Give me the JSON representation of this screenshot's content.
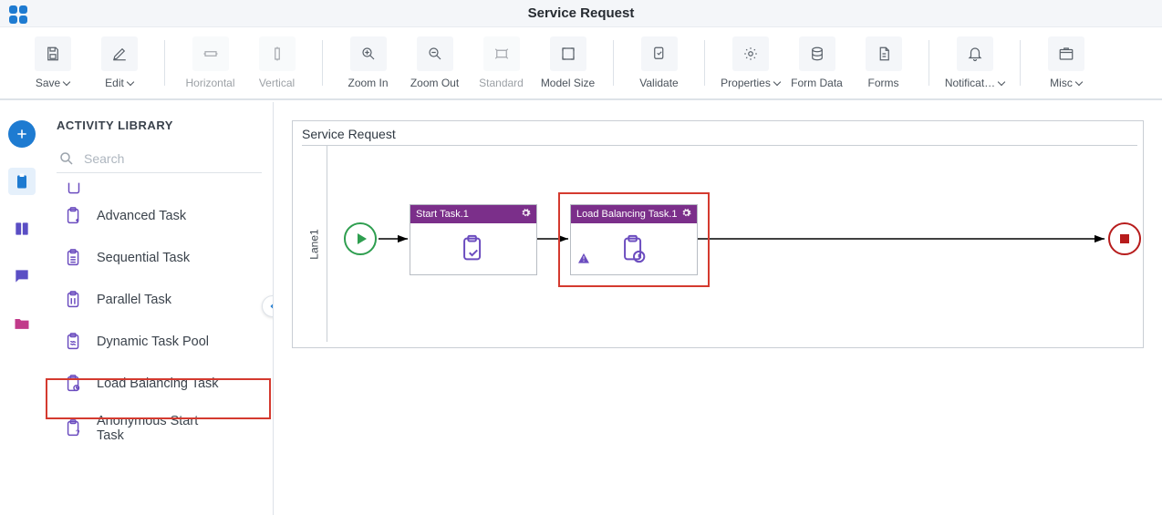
{
  "header": {
    "title": "Service Request"
  },
  "toolbar": {
    "save": "Save",
    "edit": "Edit",
    "horizontal": "Horizontal",
    "vertical": "Vertical",
    "zoom_in": "Zoom In",
    "zoom_out": "Zoom Out",
    "standard": "Standard",
    "model_size": "Model Size",
    "validate": "Validate",
    "properties": "Properties",
    "form_data": "Form Data",
    "forms": "Forms",
    "notifications": "Notificat…",
    "misc": "Misc"
  },
  "panel": {
    "title": "ACTIVITY LIBRARY",
    "search_placeholder": "Search",
    "items": [
      "Advanced Task",
      "Sequential Task",
      "Parallel Task",
      "Dynamic Task Pool",
      "Load Balancing Task",
      "Anonymous Start Task"
    ]
  },
  "canvas": {
    "title": "Service Request",
    "lane": "Lane1",
    "tasks": [
      {
        "title": "Start Task.1"
      },
      {
        "title": "Load Balancing Task.1"
      }
    ]
  }
}
